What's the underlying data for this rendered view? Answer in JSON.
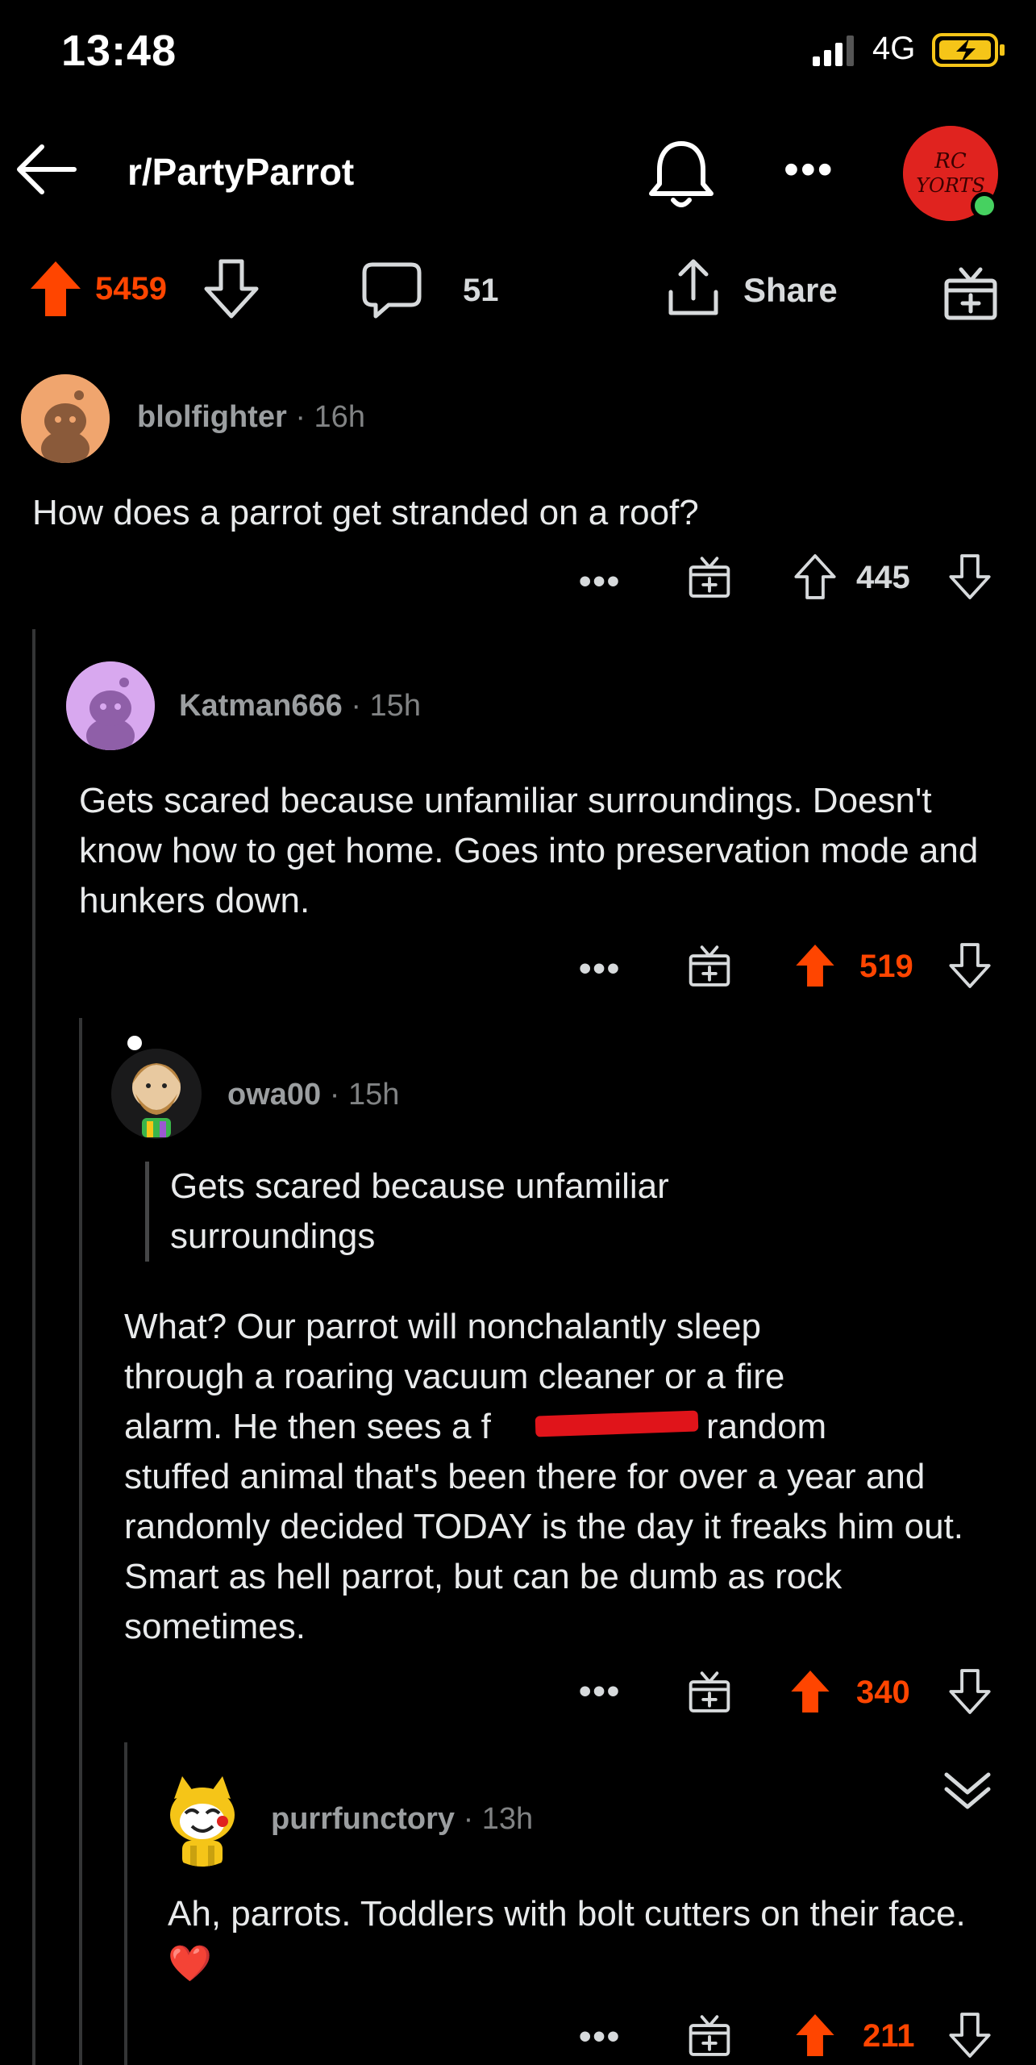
{
  "status_bar": {
    "time": "13:48",
    "network": "4G"
  },
  "header": {
    "subreddit": "r/PartyParrot",
    "avatar_text": "RC YORTS"
  },
  "post_bar": {
    "score": "5459",
    "comments": "51",
    "share_label": "Share"
  },
  "comments": [
    {
      "user": "blolfighter",
      "age": "16h",
      "body": "How does a parrot get stranded on a roof?",
      "score": "445",
      "voted": false
    },
    {
      "user": "Katman666",
      "age": "15h",
      "body": "Gets scared because unfamiliar surroundings. Doesn't know how to get home. Goes into preservation mode and hunkers down.",
      "score": "519",
      "voted": true
    },
    {
      "user": "owa00",
      "age": "15h",
      "quote": "Gets scared because unfamiliar surroundings",
      "body_line1": "What? Our parrot will nonchalantly sleep",
      "body_line2": "through a roaring vacuum cleaner or a fire",
      "body_line3_a": "alarm. He then sees a f",
      "body_line3_b": "random",
      "body_rest": "stuffed animal that's been there for over a year and randomly decided TODAY is the day it freaks him out. Smart as hell parrot, but can be dumb as rock sometimes.",
      "score": "340",
      "voted": true
    },
    {
      "user": "purrfunctory",
      "age": "13h",
      "body": "Ah, parrots. Toddlers with bolt cutters on their face.",
      "emoji": "❤️",
      "score": "211",
      "voted": true
    }
  ],
  "colors": {
    "upvote": "#ff4500",
    "background": "#000000",
    "online": "#46d160"
  }
}
